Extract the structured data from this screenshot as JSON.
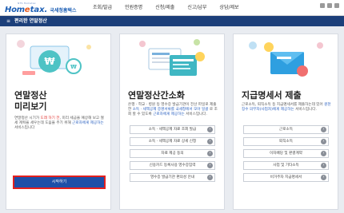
{
  "header": {
    "logo_tiny": "NTS Hometax",
    "logo_hom": "Hom",
    "logo_e": "e",
    "logo_tax": "tax.",
    "logo_sub": "국세청홈택스",
    "nav": [
      "조회/발급",
      "민원증명",
      "신청/제출",
      "신고/납부",
      "상담/제보"
    ]
  },
  "subbar": {
    "title": "편리한 연말정산"
  },
  "panels": [
    {
      "title_line1": "연말정산",
      "title_line2": "미리보기",
      "desc_1": "연말정산 시기가 ",
      "desc_red": "도래 하기 전",
      "desc_2": ", 미리 세금을 예상해 보고 절세 계획을 세우는데 도움을 주기 위해 ",
      "desc_blue": "근로자에게 제공하는",
      "desc_3": " 서비스입니다",
      "button": "시작하기"
    },
    {
      "title": "연말정산간소화",
      "desc_1": "은행 · 학교 · 병원 등 영수증 발급기관이 전산 파일로 제출한 ",
      "desc_blue": "소득 · 세액공제 증명서류를 국세청에서 모아 일괄",
      "desc_2": " 로 조회 할 수 있도록 ",
      "desc_blue2": "근로자에게 제공하는",
      "desc_3": " 서비스입니다.",
      "links": [
        "소득 · 세액공제 자료 조회 발급",
        "소득 · 세액공제 자료 상세 신청",
        "자료 제공 동의",
        "신용카드 등록사용 영수증입력",
        "영수증 발급기관 편의성 안내"
      ]
    },
    {
      "title": "지급명세서 제출",
      "desc_1": "근로소득, 퇴직소득 등 지급명세서를 제출하는데 있어 ",
      "desc_blue": "원천징수 의무자(사업자)에게 제공하는",
      "desc_2": " 서비스입니다.",
      "links": [
        "근로소득",
        "퇴직소득",
        "이자배당 및 판결계약",
        "사업 및 기타소득",
        "비거주자 지급명세서"
      ]
    }
  ],
  "colors": {
    "navy": "#1c3f7a",
    "button_blue": "#1e4fa8",
    "highlight_red": "#e3201e",
    "brand_orange": "#e8591c"
  }
}
